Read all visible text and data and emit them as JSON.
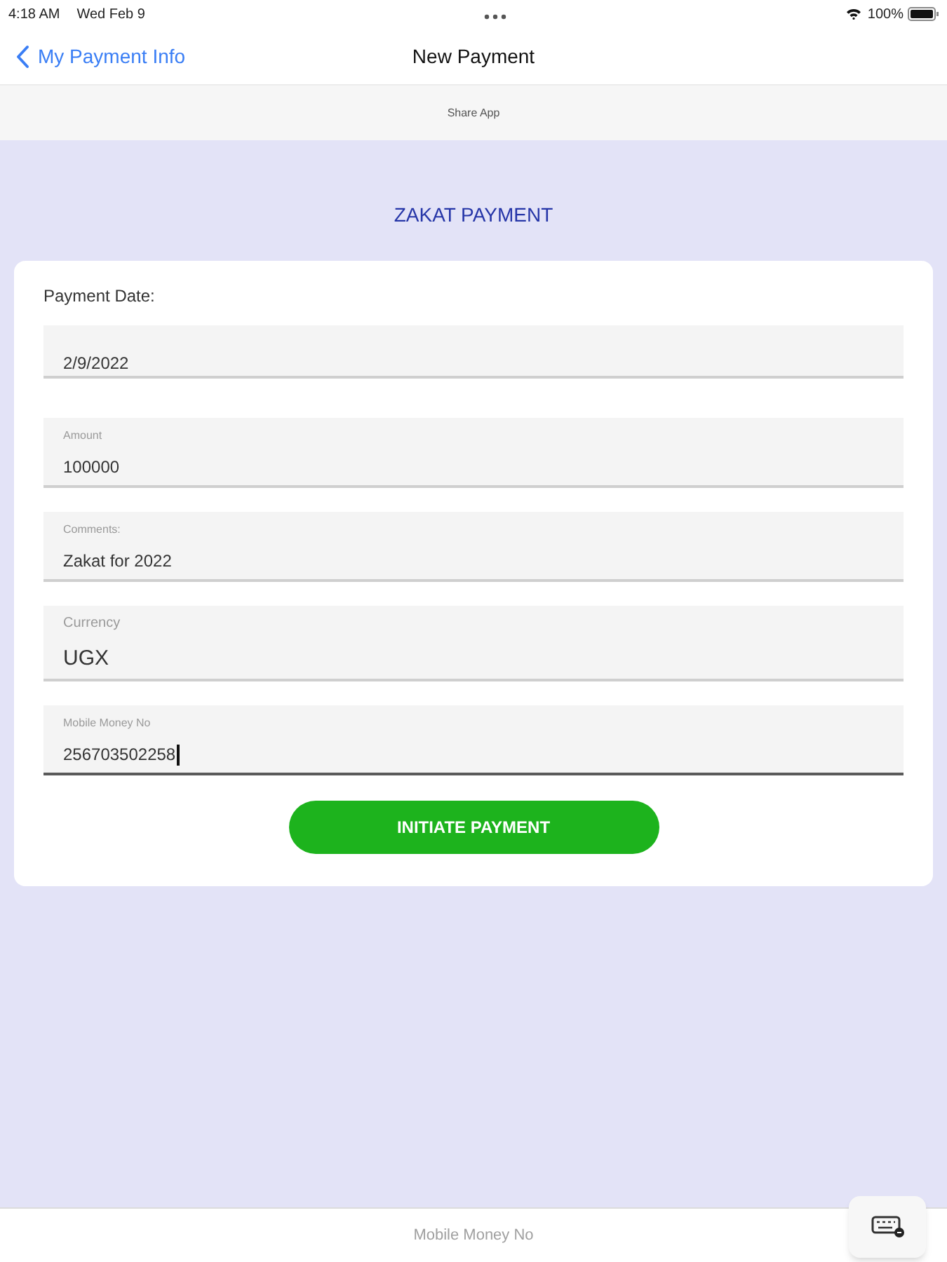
{
  "status_bar": {
    "time": "4:18 AM",
    "date": "Wed Feb 9",
    "battery": "100%"
  },
  "nav_bar": {
    "back_label": "My Payment Info",
    "title": "New Payment"
  },
  "share_bar": {
    "label": "Share App"
  },
  "form": {
    "heading": "ZAKAT PAYMENT",
    "payment_date": {
      "label": "Payment Date:",
      "value": "2/9/2022"
    },
    "fields": [
      {
        "kind": "entry",
        "label": "Amount",
        "value": "100000",
        "focused": false
      },
      {
        "kind": "entry",
        "label": "Comments:",
        "value": "Zakat for 2022",
        "focused": false
      },
      {
        "kind": "picker",
        "label": "Currency",
        "value": "UGX",
        "focused": false
      },
      {
        "kind": "entry",
        "label": "Mobile Money No",
        "value": "256703502258",
        "focused": true
      }
    ],
    "submit_button": "INITIATE PAYMENT"
  },
  "keyboard_toolbar": {
    "field_label": "Mobile Money No"
  }
}
